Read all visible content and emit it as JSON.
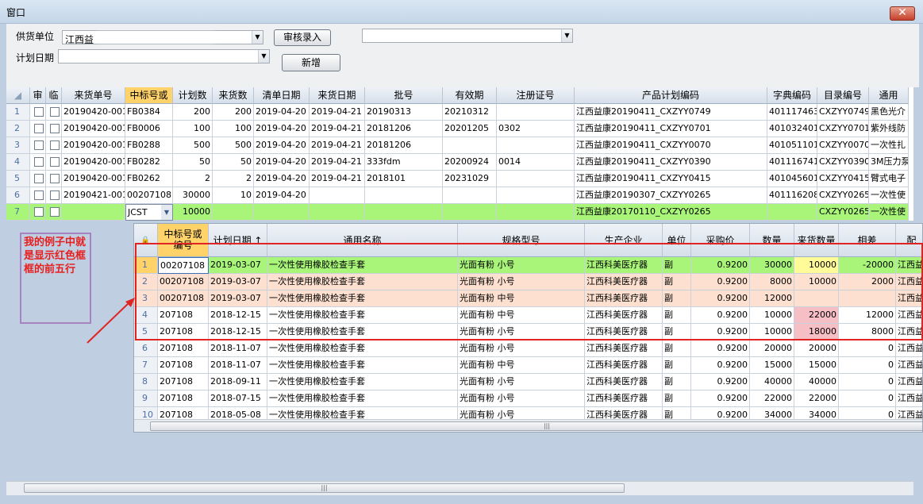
{
  "window": {
    "title": "窗口",
    "close": "✕"
  },
  "form": {
    "supplier_label": "供货单位",
    "supplier_value": "江西益",
    "plan_date_label": "计划日期",
    "plan_date_value": "",
    "review_button": "审核录入",
    "new_button": "新增",
    "extra_combo_value": ""
  },
  "grid": {
    "headers": [
      "审",
      "临",
      "来货单号",
      "中标号或",
      "计划数",
      "来货数",
      "清单日期",
      "来货日期",
      "批号",
      "有效期",
      "注册证号",
      "产品计划编码",
      "字典编码",
      "目录编号",
      "通用"
    ],
    "rows": [
      [
        "1",
        "20190420-001",
        "FB0384",
        "200",
        "200",
        "2019-04-20",
        "2019-04-21",
        "20190313",
        "20210312",
        "",
        "江西益康20190411_CXZYY0749",
        "401117463",
        "CXZYY0749",
        "黑色光介"
      ],
      [
        "2",
        "20190420-001",
        "FB0006",
        "100",
        "100",
        "2019-04-20",
        "2019-04-21",
        "20181206",
        "20201205",
        "0302",
        "江西益康20190411_CXZYY0701",
        "401032401",
        "CXZYY0701",
        "紫外线防"
      ],
      [
        "3",
        "20190420-001",
        "FB0288",
        "500",
        "500",
        "2019-04-20",
        "2019-04-21",
        "20181206",
        "",
        "",
        "江西益康20190411_CXZYY0070",
        "401051101",
        "CXZYY0070",
        "一次性扎"
      ],
      [
        "4",
        "20190420-001",
        "FB0282",
        "50",
        "50",
        "2019-04-20",
        "2019-04-21",
        "333fdm",
        "20200924",
        "0014",
        "江西益康20190411_CXZYY0390",
        "401116741",
        "CXZYY0390",
        "3M压力泵"
      ],
      [
        "5",
        "20190420-001",
        "FB0262",
        "2",
        "2",
        "2019-04-20",
        "2019-04-21",
        "2018101",
        "20231029",
        "",
        "江西益康20190411_CXZYY0415",
        "401045601",
        "CXZYY0415",
        "臂式电子"
      ],
      [
        "6",
        "20190421-001",
        "00207108",
        "30000",
        "10",
        "2019-04-20",
        "",
        "",
        "",
        "",
        "江西益康20190307_CXZYY0265",
        "401116208",
        "CXZYY0265",
        "一次性使"
      ],
      [
        "7",
        "",
        "JCST",
        "10000",
        "",
        "",
        "",
        "",
        "",
        "",
        "江西益康20170110_CXZYY0265",
        "",
        "CXZYY0265",
        "一次性使"
      ]
    ]
  },
  "popup": {
    "lock_icon": "lock-icon",
    "headers": [
      "中标号或\n编号",
      "计划日期 ↑",
      "通用名称",
      "规格型号",
      "生产企业",
      "单位",
      "采购价",
      "数量",
      "来货数量",
      "相差",
      "配"
    ],
    "rows": [
      [
        "1",
        "00207108",
        "2019-03-07",
        "一次性使用橡胶检查手套",
        "光面有粉 小号",
        "江西科美医疗器",
        "副",
        "0.9200",
        "30000",
        "10000",
        "-20000",
        "江西益"
      ],
      [
        "2",
        "00207108",
        "2019-03-07",
        "一次性使用橡胶检查手套",
        "光面有粉 小号",
        "江西科美医疗器",
        "副",
        "0.9200",
        "8000",
        "10000",
        "2000",
        "江西益"
      ],
      [
        "3",
        "00207108",
        "2019-03-07",
        "一次性使用橡胶检查手套",
        "光面有粉 中号",
        "江西科美医疗器",
        "副",
        "0.9200",
        "12000",
        "",
        "",
        "江西益"
      ],
      [
        "4",
        "207108",
        "2018-12-15",
        "一次性使用橡胶检查手套",
        "光面有粉 中号",
        "江西科美医疗器",
        "副",
        "0.9200",
        "10000",
        "22000",
        "12000",
        "江西益"
      ],
      [
        "5",
        "207108",
        "2018-12-15",
        "一次性使用橡胶检查手套",
        "光面有粉 小号",
        "江西科美医疗器",
        "副",
        "0.9200",
        "10000",
        "18000",
        "8000",
        "江西益"
      ],
      [
        "6",
        "207108",
        "2018-11-07",
        "一次性使用橡胶检查手套",
        "光面有粉 小号",
        "江西科美医疗器",
        "副",
        "0.9200",
        "20000",
        "20000",
        "0",
        "江西益"
      ],
      [
        "7",
        "207108",
        "2018-11-07",
        "一次性使用橡胶检查手套",
        "光面有粉 中号",
        "江西科美医疗器",
        "副",
        "0.9200",
        "15000",
        "15000",
        "0",
        "江西益"
      ],
      [
        "8",
        "207108",
        "2018-09-11",
        "一次性使用橡胶检查手套",
        "光面有粉 小号",
        "江西科美医疗器",
        "副",
        "0.9200",
        "40000",
        "40000",
        "0",
        "江西益"
      ],
      [
        "9",
        "207108",
        "2018-07-15",
        "一次性使用橡胶检查手套",
        "光面有粉 小号",
        "江西科美医疗器",
        "副",
        "0.9200",
        "22000",
        "22000",
        "0",
        "江西益"
      ],
      [
        "10",
        "207108",
        "2018-05-08",
        "一次性使用橡胶检查手套",
        "光面有粉 小号",
        "江西科美医疗器",
        "副",
        "0.9200",
        "34000",
        "34000",
        "0",
        "江西益"
      ]
    ]
  },
  "annotation": {
    "text": "我的例子中就是显示红色框框的前五行"
  },
  "colors": {
    "selected_header": "#ffd26a",
    "new_row": "#a9f57a",
    "highlight_row": "#fde0cf",
    "annotation": "#e81e1e",
    "redbox": "#e02424"
  }
}
